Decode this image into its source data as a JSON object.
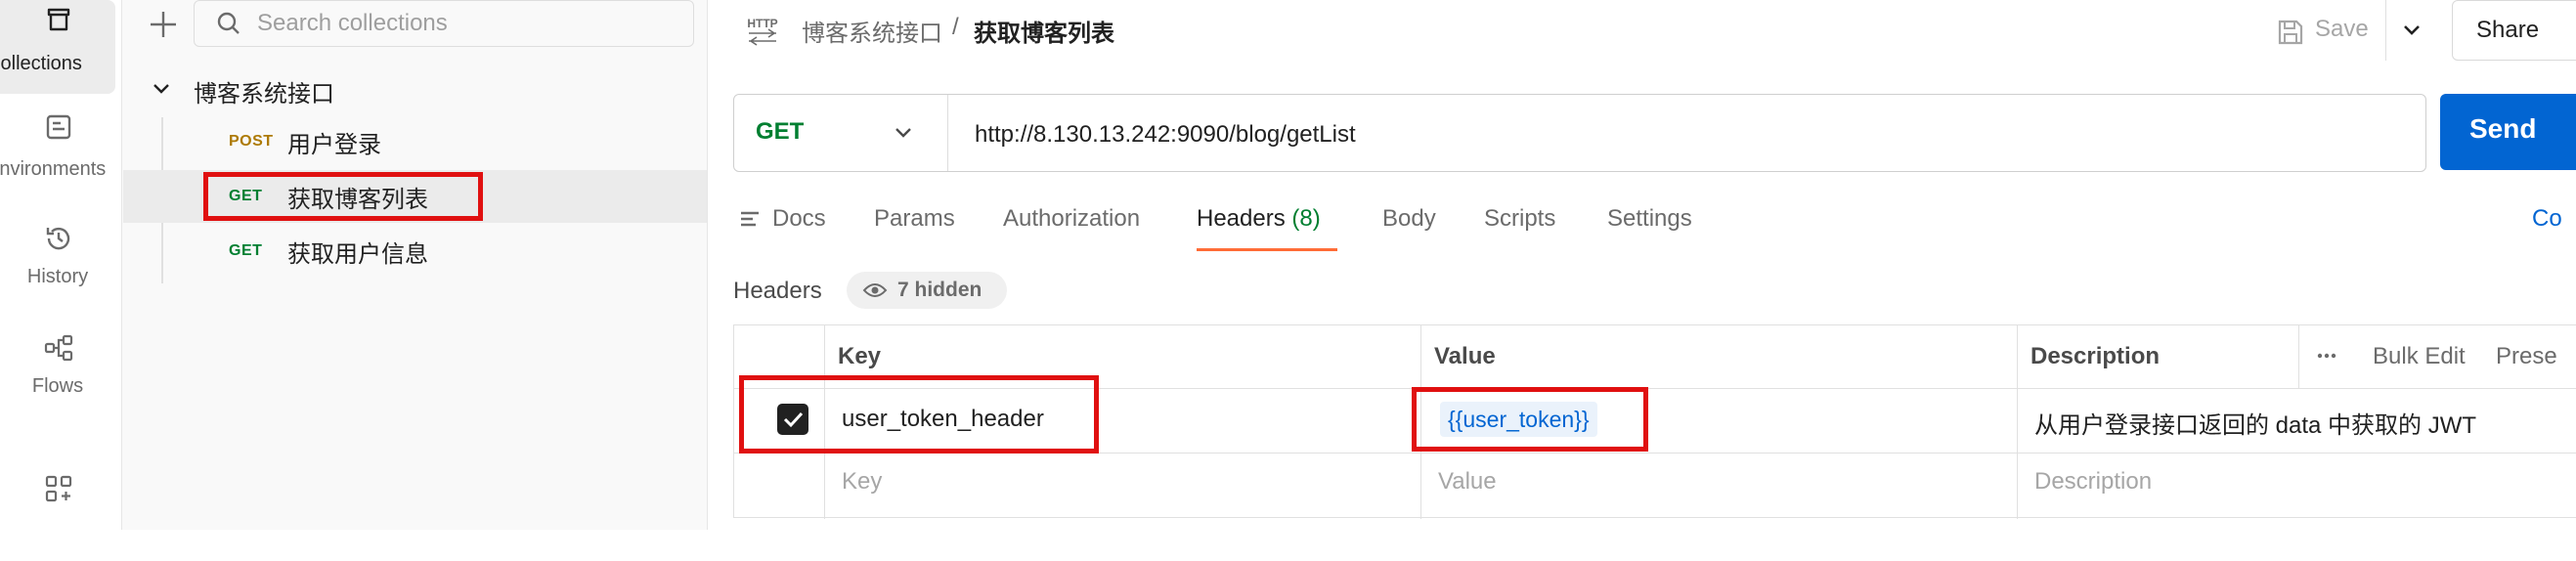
{
  "rail": {
    "items": [
      {
        "label": "Collections",
        "icon": "collections-icon"
      },
      {
        "label": "Environments",
        "icon": "environments-icon"
      },
      {
        "label": "History",
        "icon": "history-icon"
      },
      {
        "label": "Flows",
        "icon": "flows-icon"
      },
      {
        "label": "",
        "icon": "apps-icon"
      }
    ]
  },
  "sidebar": {
    "search_placeholder": "Search collections",
    "collection": {
      "name": "博客系统接口",
      "requests": [
        {
          "method": "POST",
          "name": "用户登录"
        },
        {
          "method": "GET",
          "name": "获取博客列表"
        },
        {
          "method": "GET",
          "name": "获取用户信息"
        }
      ]
    }
  },
  "header": {
    "protocol_icon": "HTTP",
    "breadcrumb_parent": "博客系统接口",
    "breadcrumb_sep": "/",
    "breadcrumb_current": "获取博客列表",
    "save_label": "Save",
    "share_label": "Share"
  },
  "request": {
    "method": "GET",
    "url": "http://8.130.13.242:9090/blog/getList",
    "send_label": "Send"
  },
  "tabs": {
    "docs": "Docs",
    "params": "Params",
    "authorization": "Authorization",
    "headers": "Headers",
    "headers_count": "(8)",
    "body": "Body",
    "scripts": "Scripts",
    "settings": "Settings",
    "cookies": "Co"
  },
  "headers_section": {
    "title": "Headers",
    "hidden_label": "7 hidden",
    "columns": {
      "key": "Key",
      "value": "Value",
      "description": "Description"
    },
    "bulk_edit": "Bulk Edit",
    "presets": "Prese",
    "rows": [
      {
        "checked": true,
        "key": "user_token_header",
        "value": "{{user_token}}",
        "description": "从用户登录接口返回的 data 中获取的 JWT"
      }
    ],
    "placeholder": {
      "key": "Key",
      "value": "Value",
      "description": "Description"
    }
  },
  "colors": {
    "accent": "#ff6c37",
    "send": "#0265d2",
    "get": "#007f31",
    "post": "#ad7a03",
    "highlight": "#e01010"
  }
}
